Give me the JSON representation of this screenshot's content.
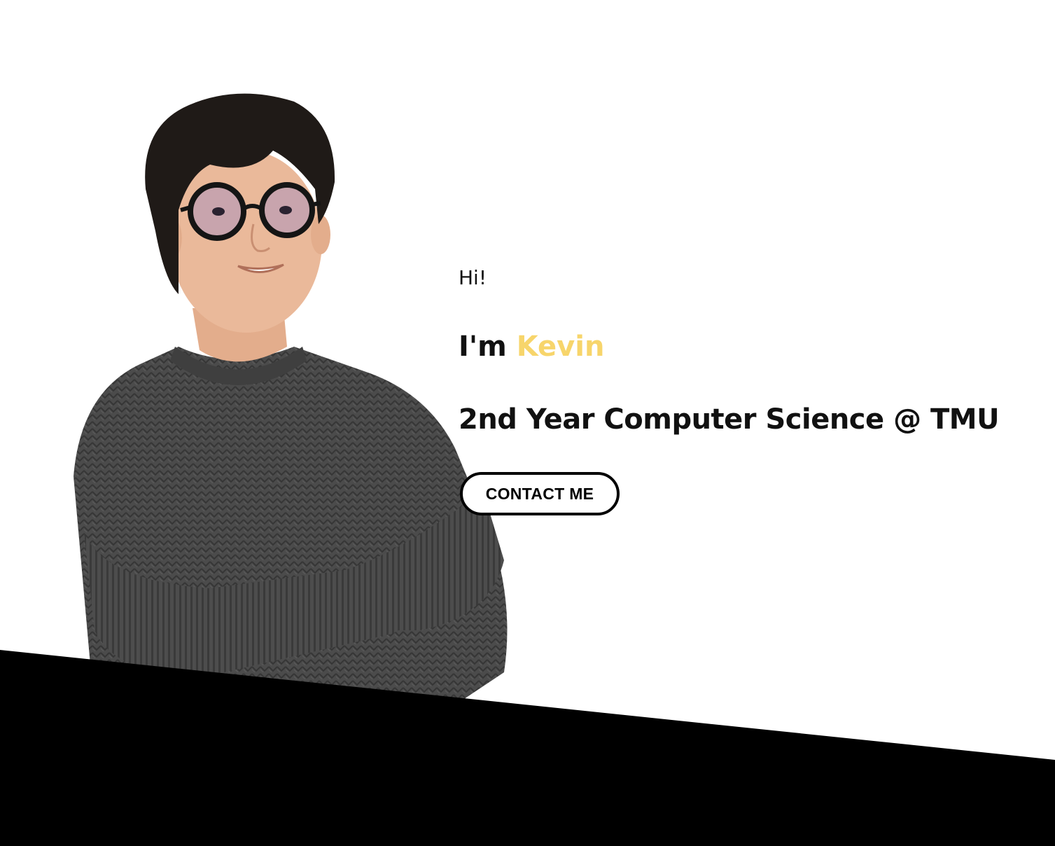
{
  "hero": {
    "greeting": "Hi!",
    "intro_prefix": "I'm ",
    "name": "Kevin",
    "subtitle": "2nd Year Computer Science @ TMU",
    "contact_label": "CONTACT ME"
  },
  "colors": {
    "accent": "#f7d56b",
    "text": "#111111",
    "background": "#ffffff",
    "footer": "#000000",
    "sweater": "#4a4a4a",
    "hair": "#1f1a17",
    "skin": "#e9b99a"
  },
  "icons": {
    "portrait": "person-photo"
  }
}
